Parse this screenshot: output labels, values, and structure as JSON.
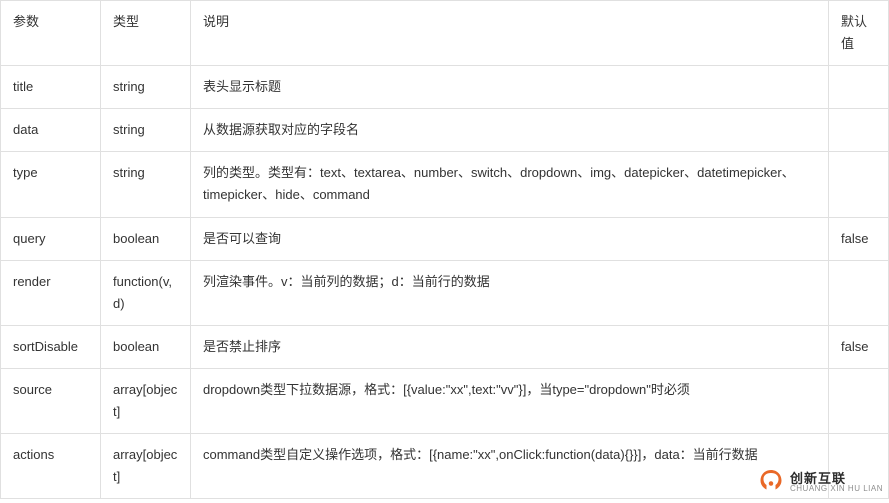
{
  "table": {
    "headers": {
      "param": "参数",
      "type": "类型",
      "desc": "说明",
      "default": "默认值"
    },
    "rows": [
      {
        "param": "title",
        "type": "string",
        "desc": "表头显示标题",
        "default": ""
      },
      {
        "param": "data",
        "type": "string",
        "desc": "从数据源获取对应的字段名",
        "default": ""
      },
      {
        "param": "type",
        "type": "string",
        "desc": "列的类型。类型有：text、textarea、number、switch、dropdown、img、datepicker、datetimepicker、timepicker、hide、command",
        "default": ""
      },
      {
        "param": "query",
        "type": "boolean",
        "desc": "是否可以查询",
        "default": "false"
      },
      {
        "param": "render",
        "type": "function(v,d)",
        "desc": "列渲染事件。v：当前列的数据；d：当前行的数据",
        "default": ""
      },
      {
        "param": "sortDisable",
        "type": "boolean",
        "desc": "是否禁止排序",
        "default": "false"
      },
      {
        "param": "source",
        "type": "array[object]",
        "desc": "dropdown类型下拉数据源，格式：[{value:\"xx\",text:\"vv\"}]，当type=\"dropdown\"时必须",
        "default": ""
      },
      {
        "param": "actions",
        "type": "array[object]",
        "desc": "command类型自定义操作选项，格式：[{name:\"xx\",onClick:function(data){}}]，data：当前行数据",
        "default": ""
      }
    ]
  },
  "watermark": {
    "cn": "创新互联",
    "en": "CHUANG XIN HU LIAN"
  }
}
